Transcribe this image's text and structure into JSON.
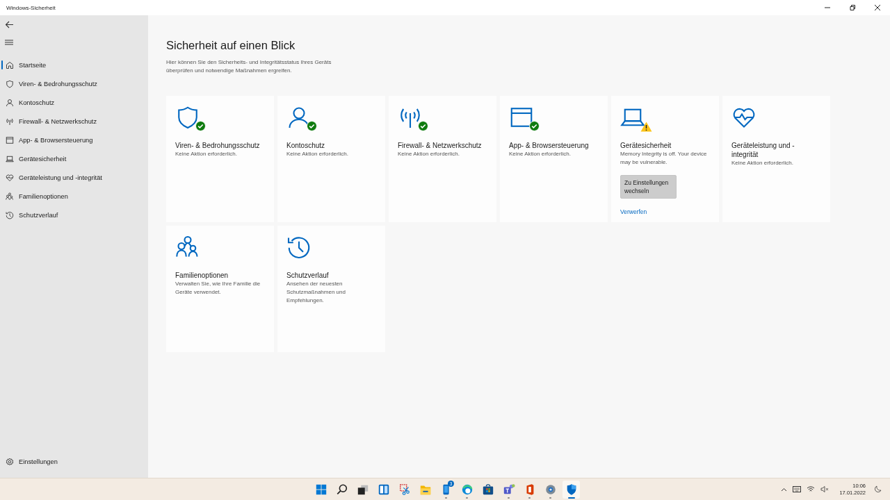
{
  "window": {
    "title": "Windows-Sicherheit"
  },
  "sidebar": {
    "items": [
      {
        "label": "Startseite",
        "selected": true
      },
      {
        "label": "Viren- & Bedrohungsschutz",
        "selected": false
      },
      {
        "label": "Kontoschutz",
        "selected": false
      },
      {
        "label": "Firewall- & Netzwerkschutz",
        "selected": false
      },
      {
        "label": "App- & Browsersteuerung",
        "selected": false
      },
      {
        "label": "Gerätesicherheit",
        "selected": false
      },
      {
        "label": "Geräteleistung und -integrität",
        "selected": false
      },
      {
        "label": "Familienoptionen",
        "selected": false
      },
      {
        "label": "Schutzverlauf",
        "selected": false
      }
    ],
    "footer": {
      "label": "Einstellungen"
    }
  },
  "main": {
    "title": "Sicherheit auf einen Blick",
    "description": "Hier können Sie den Sicherheits- und Integritätsstatus Ihres Geräts überprüfen und notwendige Maßnahmen ergreifen.",
    "cards": [
      {
        "title": "Viren- & Bedrohungsschutz",
        "text": "Keine Aktion erforderlich.",
        "ok": true,
        "warning": false
      },
      {
        "title": "Kontoschutz",
        "text": "Keine Aktion erforderlich.",
        "ok": true,
        "warning": false
      },
      {
        "title": "Firewall- & Netzwerkschutz",
        "text": "Keine Aktion erforderlich.",
        "ok": true,
        "warning": false
      },
      {
        "title": "App- & Browsersteuerung",
        "text": "Keine Aktion erforderlich.",
        "ok": true,
        "warning": false
      },
      {
        "title": "Gerätesicherheit",
        "text": "Memory Integrity is off. Your device may be vulnerable.",
        "ok": false,
        "warning": true,
        "button": "Zu Einstellungen wechseln",
        "link": "Verwerfen"
      },
      {
        "title": "Geräteleistung und -integrität",
        "text": "Keine Aktion erforderlich.",
        "ok": false,
        "warning": false
      },
      {
        "title": "Familienoptionen",
        "text": "Verwalten Sie, wie Ihre Familie die Geräte verwendet.",
        "ok": false,
        "warning": false
      },
      {
        "title": "Schutzverlauf",
        "text": "Ansehen der neuesten Schutzmaßnahmen und Empfehlungen.",
        "ok": false,
        "warning": false
      }
    ]
  },
  "taskbar": {
    "apps": [
      {
        "running": false,
        "selected": false
      },
      {
        "running": false,
        "selected": false
      },
      {
        "running": false,
        "selected": false
      },
      {
        "running": false,
        "selected": false
      },
      {
        "running": false,
        "selected": false
      },
      {
        "running": false,
        "selected": false
      },
      {
        "running": true,
        "selected": false,
        "badge": "3"
      },
      {
        "running": true,
        "selected": false
      },
      {
        "running": false,
        "selected": false
      },
      {
        "running": true,
        "selected": false
      },
      {
        "running": true,
        "selected": false
      },
      {
        "running": true,
        "selected": false
      },
      {
        "running": true,
        "selected": true
      }
    ],
    "time": "10:06",
    "date": "17.01.2022"
  }
}
